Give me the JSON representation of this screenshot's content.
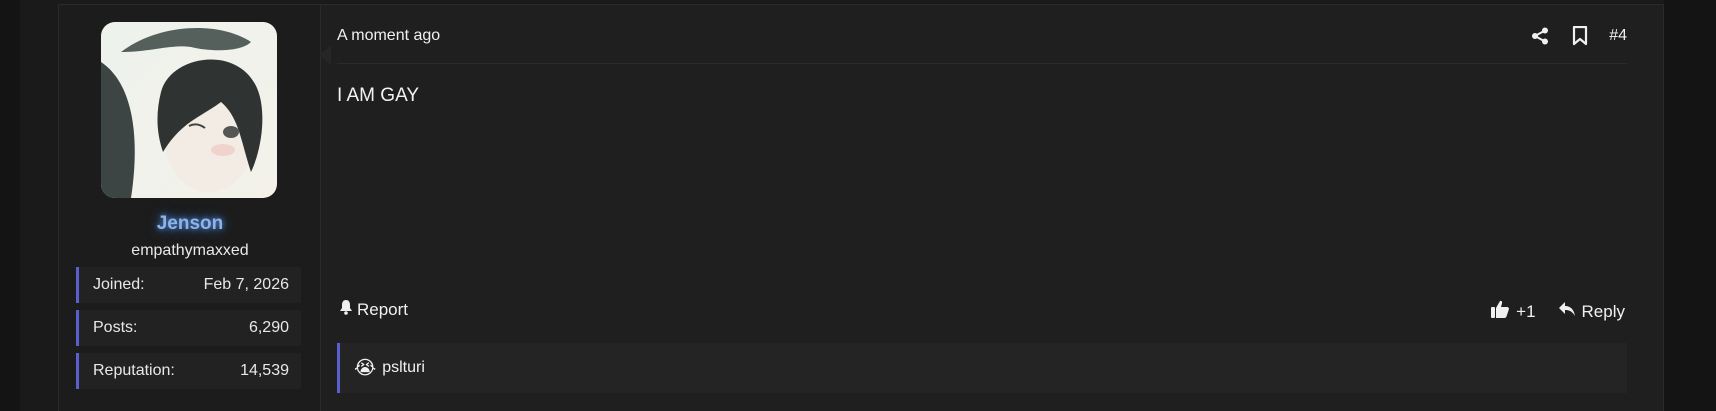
{
  "post": {
    "timestamp": "A moment ago",
    "number": "#4",
    "content": "I AM GAY",
    "icons": {
      "share": "share-icon",
      "bookmark": "bookmark-icon",
      "report": "bell-icon",
      "like": "thumbs-up-icon",
      "reply": "reply-icon"
    }
  },
  "user": {
    "name": "Jenson",
    "title": "empathymaxxed",
    "avatar": "avatar",
    "stats": [
      {
        "label": "Joined:",
        "value": "Feb 7, 2026"
      },
      {
        "label": "Posts:",
        "value": "6,290"
      },
      {
        "label": "Reputation:",
        "value": "14,539"
      }
    ]
  },
  "actions": {
    "report": "Report",
    "like_count": "+1",
    "reply": "Reply"
  },
  "reactions": {
    "emoji": "😭",
    "users": "pslturi"
  },
  "colors": {
    "accent": "#5a5fd0",
    "username": "#8fb3e6",
    "background": "#1f1f1f"
  }
}
